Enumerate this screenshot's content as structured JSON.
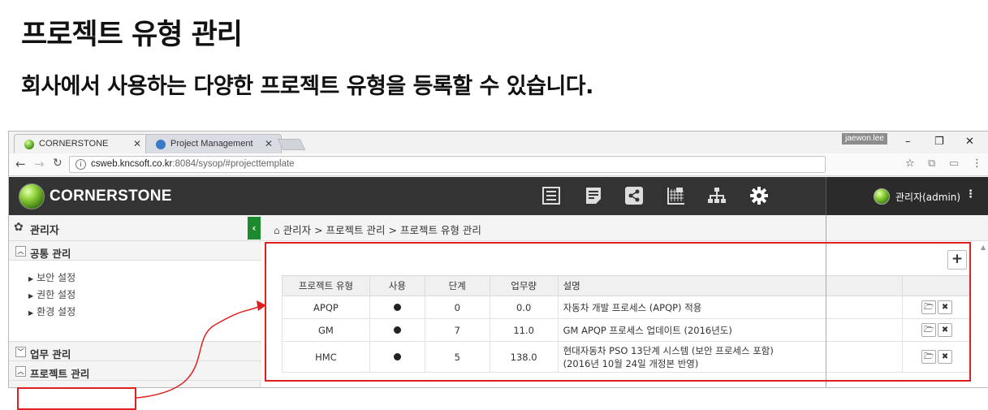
{
  "title": "프로젝트 유형 관리",
  "subtitle": "회사에서 사용하는 다양한 프로젝트 유형을 등록할 수 있습니다.",
  "browser": {
    "tabs": [
      {
        "label": "CORNERSTONE",
        "active": true
      },
      {
        "label": "Project Management",
        "active": false
      }
    ],
    "user_chip": "jaewon.lee",
    "url_host": "csweb.kncsoft.co.kr",
    "url_rest": ":8084/sysop/#projecttemplate"
  },
  "app": {
    "brand": "CORNERSTONE",
    "admin_user": "관리자(admin)",
    "nav_icons": [
      "list-icon",
      "document-icon",
      "share-icon",
      "gantt-chart-icon",
      "org-chart-icon",
      "settings-gear-icon"
    ]
  },
  "sidebar": {
    "title": "관리자",
    "sections": [
      {
        "label": "공통 관리",
        "expanded": true,
        "items": [
          "보안 설정",
          "권한 설정",
          "환경 설정"
        ]
      },
      {
        "label": "업무 관리",
        "expanded": false
      },
      {
        "label": "프로젝트 관리",
        "expanded": true
      }
    ]
  },
  "breadcrumb": "관리자 > 프로젝트 관리 > 프로젝트 유형 관리",
  "table": {
    "headers": [
      "프로젝트 유형",
      "사용",
      "단계",
      "업무량",
      "설명",
      ""
    ],
    "rows": [
      {
        "type": "APQP",
        "used": true,
        "steps": "0",
        "workload": "0.0",
        "desc": "자동차 개발 프로세스 (APQP) 적용"
      },
      {
        "type": "GM",
        "used": true,
        "steps": "7",
        "workload": "11.0",
        "desc": "GM APQP 프로세스 업데이트 (2016년도)"
      },
      {
        "type": "HMC",
        "used": true,
        "steps": "5",
        "workload": "138.0",
        "desc": "현대자동차 PSO 13단계 시스템 (보안 프로세스 포함)",
        "desc2": "(2016년 10월 24일 개정본 반영)"
      }
    ]
  },
  "colors": {
    "accent_red": "#e02020",
    "header_dark": "#333333",
    "collapse_green": "#1e8a2e"
  }
}
